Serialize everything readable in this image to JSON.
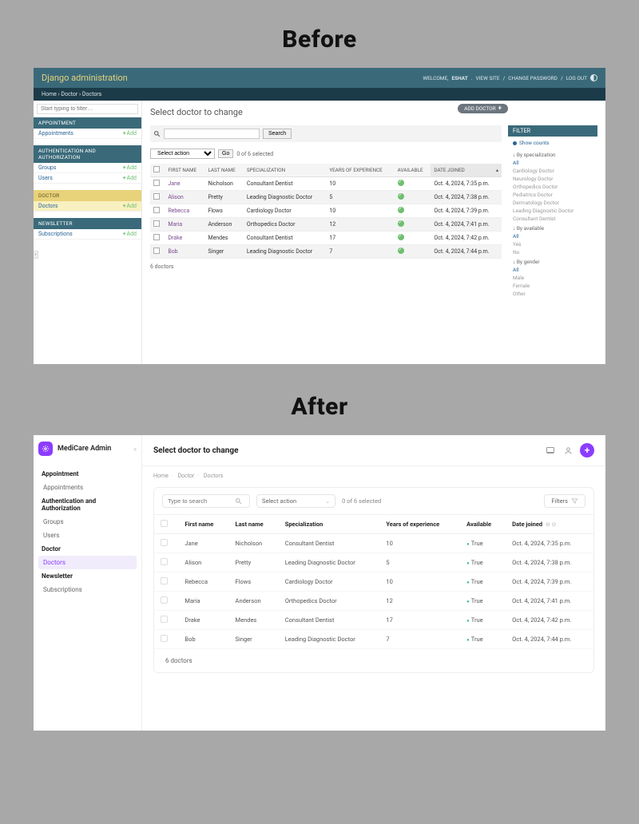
{
  "labels": {
    "before": "Before",
    "after": "After"
  },
  "before": {
    "brand": "Django administration",
    "welcome_prefix": "WELCOME,",
    "username": "ESHAT",
    "view_site": "VIEW SITE",
    "change_password": "CHANGE PASSWORD",
    "logout": "LOG OUT",
    "breadcrumb": {
      "home": "Home",
      "doctor": "Doctor",
      "doctors": "Doctors"
    },
    "sidebar": {
      "filter_placeholder": "Start typing to filter…",
      "sections": [
        {
          "label": "APPOINTMENT",
          "style": "blue",
          "items": [
            {
              "label": "Appointments",
              "add": "Add"
            }
          ]
        },
        {
          "label": "AUTHENTICATION AND AUTHORIZATION",
          "style": "blue",
          "items": [
            {
              "label": "Groups",
              "add": "Add"
            },
            {
              "label": "Users",
              "add": "Add"
            }
          ]
        },
        {
          "label": "DOCTOR",
          "style": "yellow",
          "items": [
            {
              "label": "Doctors",
              "add": "Add",
              "active": true
            }
          ]
        },
        {
          "label": "NEWSLETTER",
          "style": "blue",
          "items": [
            {
              "label": "Subscriptions",
              "add": "Add"
            }
          ]
        }
      ]
    },
    "page_title": "Select doctor to change",
    "add_button": "ADD DOCTOR",
    "search_button": "Search",
    "action_select": "Select action",
    "go": "Go",
    "selected_text": "0 of 6 selected",
    "columns": [
      "FIRST NAME",
      "LAST NAME",
      "SPECIALIZATION",
      "YEARS OF EXPERIENCE",
      "AVAILABLE",
      "DATE JOINED"
    ],
    "rows": [
      {
        "first": "Jane",
        "last": "Nicholson",
        "spec": "Consultant Dentist",
        "years": "10",
        "available": true,
        "joined": "Oct. 4, 2024, 7:35 p.m."
      },
      {
        "first": "Alison",
        "last": "Pretty",
        "spec": "Leading Diagnostic Doctor",
        "years": "5",
        "available": true,
        "joined": "Oct. 4, 2024, 7:38 p.m."
      },
      {
        "first": "Rebecca",
        "last": "Flows",
        "spec": "Cardiology Doctor",
        "years": "10",
        "available": true,
        "joined": "Oct. 4, 2024, 7:39 p.m."
      },
      {
        "first": "Maria",
        "last": "Anderson",
        "spec": "Orthopedics Doctor",
        "years": "12",
        "available": true,
        "joined": "Oct. 4, 2024, 7:41 p.m."
      },
      {
        "first": "Drake",
        "last": "Mendes",
        "spec": "Consultant Dentist",
        "years": "17",
        "available": true,
        "joined": "Oct. 4, 2024, 7:42 p.m."
      },
      {
        "first": "Bob",
        "last": "Singer",
        "spec": "Leading Diagnostic Doctor",
        "years": "7",
        "available": true,
        "joined": "Oct. 4, 2024, 7:44 p.m."
      }
    ],
    "footer": "6 doctors",
    "filter": {
      "header": "FILTER",
      "show_counts": "Show counts",
      "groups": [
        {
          "label": "By specialization",
          "options": [
            "All",
            "Cardiology Doctor",
            "Neurology Doctor",
            "Orthopedics Doctor",
            "Pediatrics Doctor",
            "Dermatology Doctor",
            "Leading Diagnostic Doctor",
            "Consultant Dentist"
          ],
          "selected": "All"
        },
        {
          "label": "By available",
          "options": [
            "All",
            "Yes",
            "No"
          ],
          "selected": "All"
        },
        {
          "label": "By gender",
          "options": [
            "All",
            "Male",
            "Female",
            "Other"
          ],
          "selected": "All"
        }
      ]
    }
  },
  "after": {
    "product": "MediCare Admin",
    "sidebar": {
      "sections": [
        {
          "label": "Appointment",
          "items": [
            {
              "label": "Appointments"
            }
          ]
        },
        {
          "label": "Authentication and Authorization",
          "items": [
            {
              "label": "Groups"
            },
            {
              "label": "Users"
            }
          ]
        },
        {
          "label": "Doctor",
          "items": [
            {
              "label": "Doctors",
              "active": true
            }
          ]
        },
        {
          "label": "Newsletter",
          "items": [
            {
              "label": "Subscriptions"
            }
          ]
        }
      ]
    },
    "page_title": "Select doctor to change",
    "breadcrumb": {
      "home": "Home",
      "doctor": "Doctor",
      "doctors": "Doctors"
    },
    "search_placeholder": "Type to search",
    "action_select": "Select action",
    "selected_text": "0 of 6 selected",
    "filters_label": "Filters",
    "columns": [
      "First name",
      "Last name",
      "Specialization",
      "Years of experience",
      "Available",
      "Date joined"
    ],
    "rows": [
      {
        "first": "Jane",
        "last": "Nicholson",
        "spec": "Consultant Dentist",
        "years": "10",
        "available": "True",
        "joined": "Oct. 4, 2024, 7:35 p.m."
      },
      {
        "first": "Alison",
        "last": "Pretty",
        "spec": "Leading Diagnostic Doctor",
        "years": "5",
        "available": "True",
        "joined": "Oct. 4, 2024, 7:38 p.m."
      },
      {
        "first": "Rebecca",
        "last": "Flows",
        "spec": "Cardiology Doctor",
        "years": "10",
        "available": "True",
        "joined": "Oct. 4, 2024, 7:39 p.m."
      },
      {
        "first": "Maria",
        "last": "Anderson",
        "spec": "Orthopedics Doctor",
        "years": "12",
        "available": "True",
        "joined": "Oct. 4, 2024, 7:41 p.m."
      },
      {
        "first": "Drake",
        "last": "Mendes",
        "spec": "Consultant Dentist",
        "years": "17",
        "available": "True",
        "joined": "Oct. 4, 2024, 7:42 p.m."
      },
      {
        "first": "Bob",
        "last": "Singer",
        "spec": "Leading Diagnostic Doctor",
        "years": "7",
        "available": "True",
        "joined": "Oct. 4, 2024, 7:44 p.m."
      }
    ],
    "footer": "6 doctors"
  }
}
